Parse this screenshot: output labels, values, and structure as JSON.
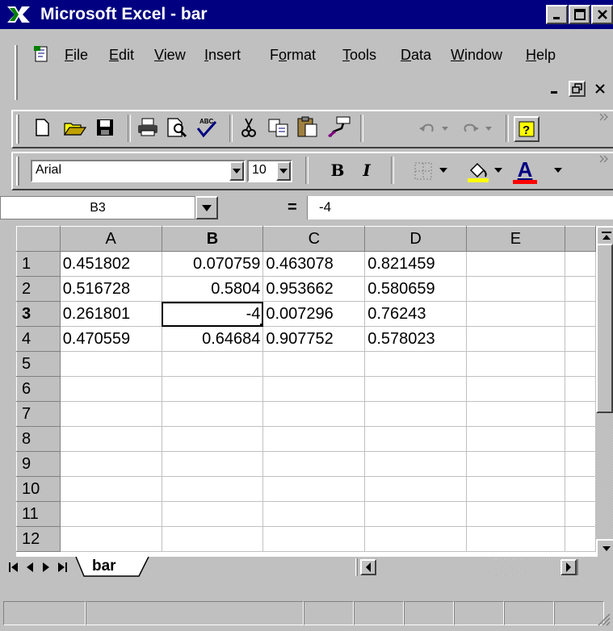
{
  "window": {
    "title": "Microsoft Excel - bar"
  },
  "menu": [
    "File",
    "Edit",
    "View",
    "Insert",
    "Format",
    "Tools",
    "Data",
    "Window",
    "Help"
  ],
  "menu_underline": [
    "F",
    "E",
    "V",
    "I",
    "o",
    "T",
    "D",
    "W",
    "H"
  ],
  "toolbar": {
    "standard": [
      "new-icon",
      "open-icon",
      "save-icon",
      "print-icon",
      "print-preview-icon",
      "spelling-icon",
      "cut-icon",
      "copy-icon",
      "paste-icon",
      "format-painter-icon",
      "undo-icon",
      "redo-icon",
      "help-icon"
    ]
  },
  "formatting": {
    "font_name": "Arial",
    "font_size": "10",
    "bold_label": "B",
    "italic_label": "I",
    "font_color_label": "A",
    "fill_color": "#ffff00",
    "font_color": "#ff0000"
  },
  "formula_bar": {
    "name_box": "B3",
    "equals": "=",
    "content": "-4"
  },
  "sheet": {
    "columns": [
      "A",
      "B",
      "C",
      "D",
      "E"
    ],
    "row_headers": [
      "1",
      "2",
      "3",
      "4",
      "5",
      "6",
      "7",
      "8",
      "9",
      "10",
      "11",
      "12"
    ],
    "active_cell": "B3",
    "rows": [
      [
        "0.451802",
        "0.070759",
        "0.463078",
        "0.821459",
        ""
      ],
      [
        "0.516728",
        "0.5804",
        "0.953662",
        "0.580659",
        ""
      ],
      [
        "0.261801",
        "-4",
        "0.007296",
        "0.76243",
        ""
      ],
      [
        "0.470559",
        "0.64684",
        "0.907752",
        "0.578023",
        ""
      ],
      [
        "",
        "",
        "",
        "",
        ""
      ],
      [
        "",
        "",
        "",
        "",
        ""
      ],
      [
        "",
        "",
        "",
        "",
        ""
      ],
      [
        "",
        "",
        "",
        "",
        ""
      ],
      [
        "",
        "",
        "",
        "",
        ""
      ],
      [
        "",
        "",
        "",
        "",
        ""
      ],
      [
        "",
        "",
        "",
        "",
        ""
      ],
      [
        "",
        "",
        "",
        "",
        ""
      ]
    ]
  },
  "tabs": {
    "active": "bar"
  }
}
